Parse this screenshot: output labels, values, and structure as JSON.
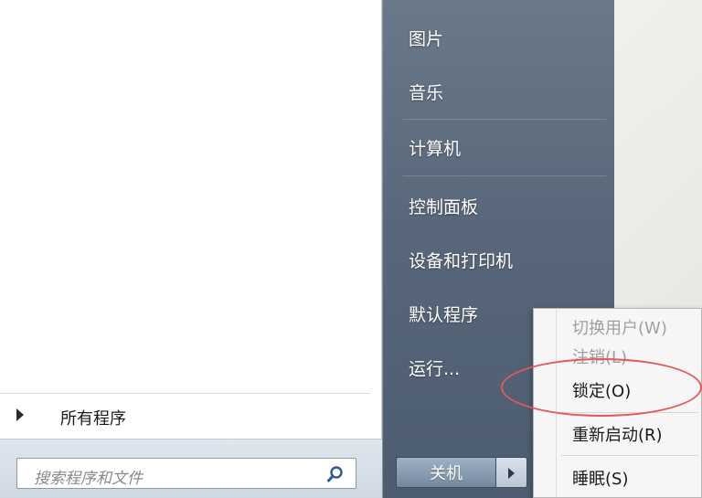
{
  "start_menu": {
    "left_pane": {
      "all_programs_label": "所有程序",
      "search_placeholder": "搜索程序和文件",
      "search_icon": "magnifier-icon"
    },
    "right_pane": {
      "items": [
        {
          "label": "图片"
        },
        {
          "label": "音乐"
        },
        {
          "label": "计算机"
        },
        {
          "label": "控制面板"
        },
        {
          "label": "设备和打印机"
        },
        {
          "label": "默认程序"
        },
        {
          "label": "运行..."
        }
      ],
      "shutdown_label": "关机",
      "shutdown_arrow_icon": "chevron-right-icon"
    },
    "power_submenu": {
      "items": [
        {
          "label": "切换用户(W)",
          "enabled": false
        },
        {
          "label": "注销(L)",
          "enabled": false
        },
        {
          "label": "锁定(O)",
          "enabled": true,
          "highlighted": true
        },
        {
          "label": "重新启动(R)",
          "enabled": true
        },
        {
          "label": "睡眠(S)",
          "enabled": true
        }
      ]
    }
  },
  "colors": {
    "right_pane": "#58687a",
    "highlight_ring": "#e05a5a"
  }
}
